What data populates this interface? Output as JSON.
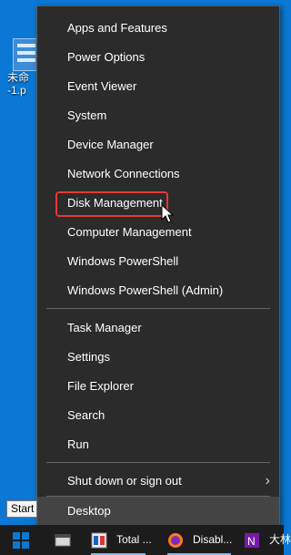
{
  "desktop": {
    "icon_label_line1": "未命",
    "icon_label_line2": "-1.p"
  },
  "menu": {
    "items": [
      {
        "label": "Apps and Features"
      },
      {
        "label": "Power Options"
      },
      {
        "label": "Event Viewer"
      },
      {
        "label": "System"
      },
      {
        "label": "Device Manager"
      },
      {
        "label": "Network Connections"
      },
      {
        "label": "Disk Management"
      },
      {
        "label": "Computer Management"
      },
      {
        "label": "Windows PowerShell"
      },
      {
        "label": "Windows PowerShell (Admin)"
      },
      {
        "label": "Task Manager"
      },
      {
        "label": "Settings"
      },
      {
        "label": "File Explorer"
      },
      {
        "label": "Search"
      },
      {
        "label": "Run"
      },
      {
        "label": "Shut down or sign out",
        "has_submenu": true
      },
      {
        "label": "Desktop"
      }
    ],
    "highlighted_item": "Disk Management",
    "hovered_item": "Desktop"
  },
  "tooltip": {
    "text": "Start"
  },
  "taskbar": {
    "apps": [
      {
        "label": "",
        "icon": "app-window-icon"
      },
      {
        "label": "Total ...",
        "icon": "total-commander-icon"
      },
      {
        "label": "Disabl...",
        "icon": "firefox-icon"
      },
      {
        "label": "大林",
        "icon": "onenote-icon"
      }
    ]
  },
  "colors": {
    "desktop_bg": "#0a78d4",
    "menu_bg": "#2b2b2b",
    "highlight_border": "#e53935",
    "taskbar_bg": "#1c1c1c"
  }
}
